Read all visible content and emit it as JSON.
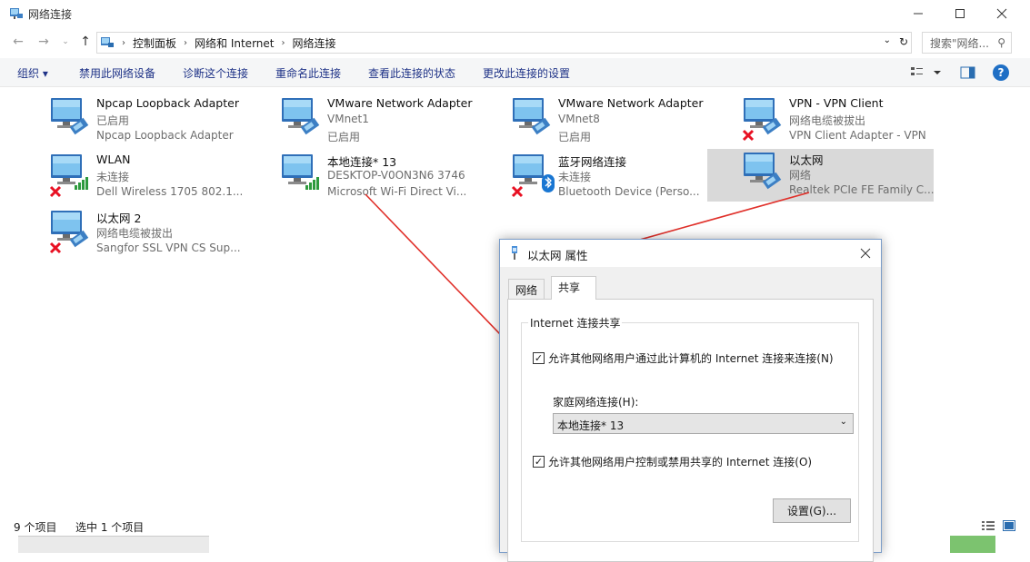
{
  "window": {
    "title": "网络连接"
  },
  "address": {
    "crumbs": [
      "控制面板",
      "网络和 Internet",
      "网络连接"
    ],
    "search_placeholder": "搜索\"网络..."
  },
  "toolbar": {
    "organize": "组织",
    "disable": "禁用此网络设备",
    "diagnose": "诊断这个连接",
    "rename": "重命名此连接",
    "status": "查看此连接的状态",
    "settings": "更改此连接的设置",
    "help": "?"
  },
  "items": [
    {
      "name": "Npcap Loopback Adapter",
      "status": "已启用",
      "device": "Npcap Loopback Adapter",
      "badge": "none"
    },
    {
      "name": "VMware Network Adapter",
      "status": "VMnet1",
      "device": "已启用",
      "badge": "none"
    },
    {
      "name": "VMware Network Adapter",
      "status": "VMnet8",
      "device": "已启用",
      "badge": "none"
    },
    {
      "name": "VPN - VPN Client",
      "status": "网络电缆被拔出",
      "device": "VPN Client Adapter - VPN",
      "badge": "x"
    },
    {
      "name": "WLAN",
      "status": "未连接",
      "device": "Dell Wireless 1705 802.1...",
      "badge": "x-wifi"
    },
    {
      "name": "本地连接* 13",
      "status": "DESKTOP-V0ON3N6 3746",
      "device": "Microsoft Wi-Fi Direct Vi...",
      "badge": "wifi"
    },
    {
      "name": "蓝牙网络连接",
      "status": "未连接",
      "device": "Bluetooth Device (Perso...",
      "badge": "x-bt"
    },
    {
      "name": "以太网",
      "status": "网络",
      "device": "Realtek PCIe FE Family C...",
      "badge": "none"
    },
    {
      "name": "以太网 2",
      "status": "网络电缆被拔出",
      "device": "Sangfor SSL VPN CS Sup...",
      "badge": "x"
    }
  ],
  "statusbar": {
    "count": "9 个项目",
    "selected": "选中 1 个项目"
  },
  "dialog": {
    "title": "以太网 属性",
    "tabs": [
      "网络",
      "共享"
    ],
    "group_label": "Internet 连接共享",
    "allow_share": "允许其他网络用户通过此计算机的 Internet 连接来连接(N)",
    "home_label": "家庭网络连接(H):",
    "home_value": "本地连接* 13",
    "allow_control": "允许其他网络用户控制或禁用共享的 Internet 连接(O)",
    "settings_btn": "设置(G)...",
    "allow_share_checked": true,
    "allow_control_checked": true
  },
  "colors": {
    "accent": "#1e3287",
    "arrow": "#e0302a",
    "selected_bg": "#d9d9d9",
    "status_x": "#e81123"
  }
}
